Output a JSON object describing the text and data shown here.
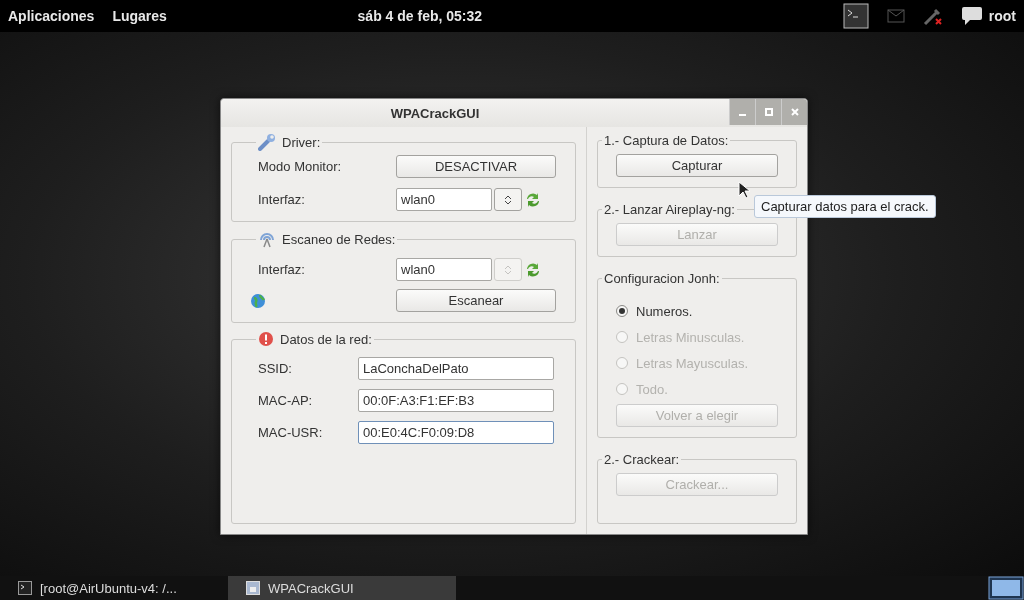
{
  "top_bar": {
    "menus": [
      "Aplicaciones",
      "Lugares"
    ],
    "clock": "sáb  4 de feb, 05:32",
    "user": "root"
  },
  "window": {
    "title": "WPACrackGUI",
    "driver": {
      "title": "Driver:",
      "monitor_label": "Modo Monitor:",
      "monitor_button": "DESACTIVAR",
      "interface_label": "Interfaz:",
      "interface_value": "wlan0",
      "spin_disabled": false
    },
    "scan": {
      "title": "Escaneo de Redes:",
      "interface_label": "Interfaz:",
      "interface_value": "wlan0",
      "spin_disabled": true,
      "scan_button": "Escanear"
    },
    "network": {
      "title": "Datos de la red:",
      "fields": [
        {
          "label": "SSID:",
          "value": "LaConchaDelPato",
          "focused": false
        },
        {
          "label": "MAC-AP:",
          "value": "00:0F:A3:F1:EF:B3",
          "focused": false
        },
        {
          "label": "MAC-USR:",
          "value": "00:E0:4C:F0:09:D8",
          "focused": true
        }
      ]
    },
    "capture": {
      "title": "1.- Captura de Datos:",
      "button": "Capturar",
      "disabled": false
    },
    "launch": {
      "title": "2.- Lanzar Aireplay-ng:",
      "button": "Lanzar",
      "disabled": true
    },
    "john": {
      "title": "Configuracion Jonh:",
      "options": [
        {
          "label": "Numeros.",
          "selected": true,
          "disabled": false
        },
        {
          "label": "Letras Minusculas.",
          "selected": false,
          "disabled": true
        },
        {
          "label": "Letras Mayusculas.",
          "selected": false,
          "disabled": true
        },
        {
          "label": "Todo.",
          "selected": false,
          "disabled": true
        }
      ],
      "button": "Volver a elegir",
      "button_disabled": true
    },
    "crack": {
      "title": "2.- Crackear:",
      "button": "Crackear...",
      "disabled": true
    }
  },
  "tooltip": "Capturar datos para el crack.",
  "taskbar": {
    "tasks": [
      {
        "label": "[root@AirUbuntu-v4: /...",
        "selected": false,
        "kind": "terminal"
      },
      {
        "label": "WPACrackGUI",
        "selected": true,
        "kind": "app"
      }
    ]
  }
}
